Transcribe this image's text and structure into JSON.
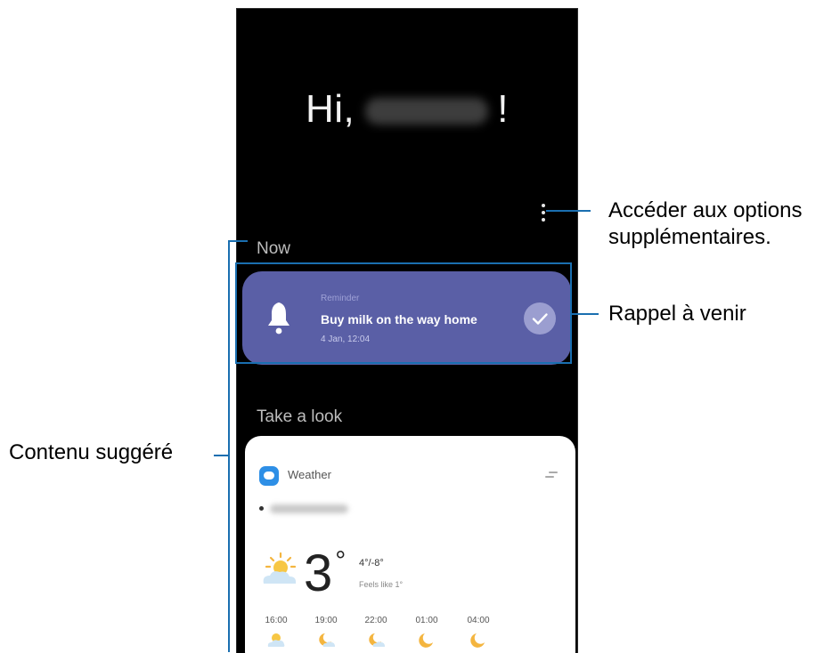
{
  "screen": {
    "greeting_prefix": "Hi,",
    "greeting_suffix": "!",
    "now_section_title": "Now",
    "take_a_look_title": "Take a look",
    "reminder": {
      "kicker": "Reminder",
      "title": "Buy milk on the way home",
      "date": "4 Jan, 12:04"
    },
    "weather": {
      "app_name": "Weather",
      "current_temp": "3",
      "degree_symbol": "°",
      "temp_range": "4°/-8°",
      "feels_like": "Feels like 1°",
      "hourly": [
        {
          "time": "16:00",
          "icon": "partly-sunny-icon"
        },
        {
          "time": "19:00",
          "icon": "moon-cloud-icon"
        },
        {
          "time": "22:00",
          "icon": "moon-cloud-icon"
        },
        {
          "time": "01:00",
          "icon": "moon-icon"
        },
        {
          "time": "04:00",
          "icon": "moon-icon"
        }
      ]
    }
  },
  "annotations": {
    "more_options_line1": "Accéder aux options",
    "more_options_line2": "supplémentaires.",
    "upcoming_reminder": "Rappel à venir",
    "suggested_content": "Contenu suggéré"
  },
  "colors": {
    "reminder_card": "#5a5fa6",
    "callout_line": "#1a6fb0",
    "screen_background": "#000000"
  }
}
